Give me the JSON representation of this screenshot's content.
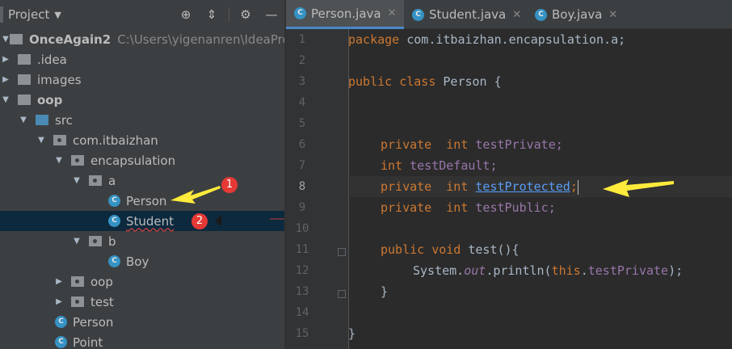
{
  "project_panel": {
    "title": "Project",
    "header_icons": [
      "crosshair-icon",
      "collapse-icon",
      "gear-icon",
      "minimize-icon"
    ],
    "tree": [
      {
        "label": "OnceAgain2",
        "path": "C:\\Users\\yigenanren\\IdeaProjec",
        "icon": "module-folder",
        "expanded": true
      },
      {
        "label": ".idea",
        "icon": "folder",
        "expanded": false
      },
      {
        "label": "images",
        "icon": "folder",
        "expanded": false
      },
      {
        "label": "oop",
        "icon": "module-folder",
        "expanded": true
      },
      {
        "label": "src",
        "icon": "source-folder",
        "expanded": true
      },
      {
        "label": "com.itbaizhan",
        "icon": "package",
        "expanded": true
      },
      {
        "label": "encapsulation",
        "icon": "package",
        "expanded": true
      },
      {
        "label": "a",
        "icon": "package",
        "expanded": true
      },
      {
        "label": "Person",
        "icon": "class"
      },
      {
        "label": "Student",
        "icon": "class",
        "selected": true
      },
      {
        "label": "b",
        "icon": "package",
        "expanded": true
      },
      {
        "label": "Boy",
        "icon": "class"
      },
      {
        "label": "oop",
        "icon": "package",
        "expanded": false
      },
      {
        "label": "test",
        "icon": "package",
        "expanded": false
      },
      {
        "label": "Person",
        "icon": "class"
      },
      {
        "label": "Point",
        "icon": "class"
      }
    ],
    "annotations": [
      "1",
      "2"
    ]
  },
  "editor": {
    "tabs": [
      {
        "label": "Person.java",
        "active": true
      },
      {
        "label": "Student.java",
        "active": false
      },
      {
        "label": "Boy.java",
        "active": false
      }
    ],
    "current_line": 8,
    "line_numbers": [
      "1",
      "2",
      "3",
      "4",
      "5",
      "6",
      "7",
      "8",
      "9",
      "10",
      "11",
      "12",
      "13",
      "14",
      "15"
    ],
    "code": {
      "l1_kw": "package",
      "l1_rest": " com.itbaizhan.encapsulation.a;",
      "l3_kw": "public class",
      "l3_rest": " Person {",
      "l6_kw1": "private",
      "l6_kw2": "int",
      "l6_id": " testPrivate;",
      "l7_kw": "int",
      "l7_id": " testDefault;",
      "l8_kw1": "private",
      "l8_kw2": "int",
      "l8_id": "testProtected",
      "l8_semi": ";",
      "l9_kw1": "private",
      "l9_kw2": "int",
      "l9_id": " testPublic;",
      "l11_kw": "public void",
      "l11_rest": " test(){",
      "l12_a": "System.",
      "l12_out": "out",
      "l12_b": ".println(",
      "l12_this": "this",
      "l12_dot": ".",
      "l12_fld": "testPrivate",
      "l12_c": ");",
      "l13": "}",
      "l15": "}"
    }
  },
  "colors": {
    "background": "#2b2b2b",
    "panel": "#3c3f41",
    "selection": "#0d293e",
    "keyword": "#cc7832",
    "field": "#9876aa",
    "class_icon": "#3592c4",
    "badge": "#e53935",
    "arrow": "#ffeb3b"
  }
}
